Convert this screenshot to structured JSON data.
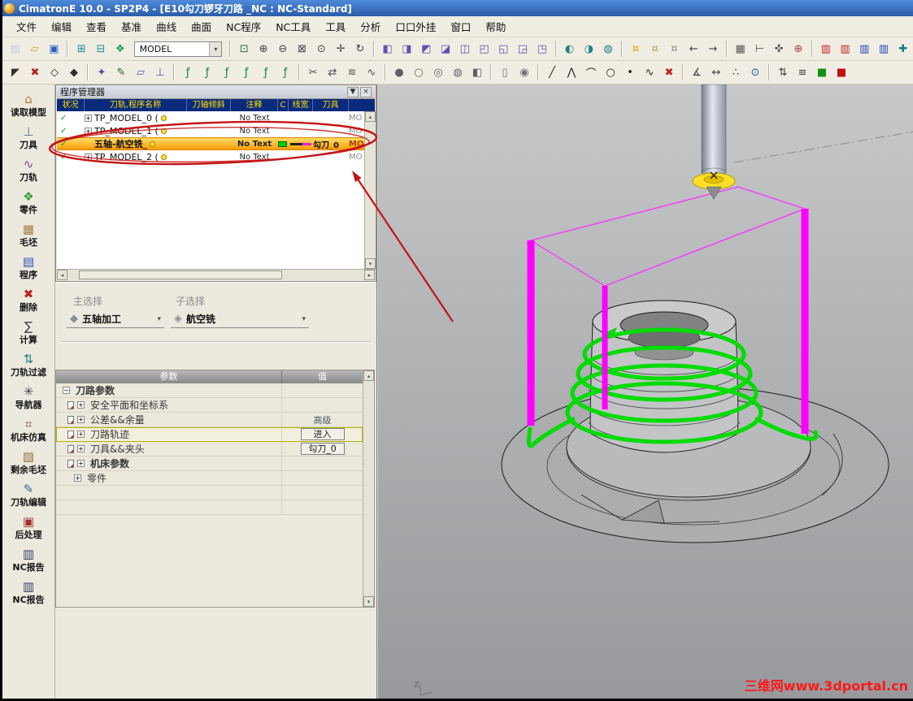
{
  "window": {
    "title": "CimatronE 10.0 - SP2P4 - [E10勾刀锣牙刀路 _NC : NC-Standard]"
  },
  "glyphs": {
    "dropdown": "▾",
    "check": "✓",
    "close": "×",
    "pin": "▼",
    "scroll_left": "◂",
    "scroll_right": "▸",
    "scroll_up": "▴",
    "scroll_down": "▾"
  },
  "menus": [
    {
      "id": "file",
      "label": "文件"
    },
    {
      "id": "edit",
      "label": "编辑"
    },
    {
      "id": "view",
      "label": "查看"
    },
    {
      "id": "datum",
      "label": "基准"
    },
    {
      "id": "curve",
      "label": "曲线"
    },
    {
      "id": "surface",
      "label": "曲面"
    },
    {
      "id": "nc-program",
      "label": "NC程序"
    },
    {
      "id": "nc-tools",
      "label": "NC工具"
    },
    {
      "id": "tools",
      "label": "工具"
    },
    {
      "id": "analysis",
      "label": "分析"
    },
    {
      "id": "plugins",
      "label": "口口外挂"
    },
    {
      "id": "window",
      "label": "窗口"
    },
    {
      "id": "help",
      "label": "帮助"
    }
  ],
  "toolbar1": {
    "model_selector": "MODEL",
    "items": [
      {
        "name": "new-file-icon",
        "glyph": "▤",
        "color": "#c8ccdc"
      },
      {
        "name": "open-file-icon",
        "glyph": "▱",
        "color": "#d89c18"
      },
      {
        "name": "save-icon",
        "glyph": "▣",
        "color": "#2a58c0"
      },
      {
        "type": "sep"
      },
      {
        "name": "import-model-icon",
        "glyph": "⊞",
        "color": "#189090"
      },
      {
        "name": "export-model-icon",
        "glyph": "⊟",
        "color": "#189090"
      },
      {
        "name": "dataset-icon",
        "glyph": "❖",
        "color": "#18a050"
      },
      {
        "type": "combo"
      },
      {
        "type": "sep"
      },
      {
        "name": "zoom-window-icon",
        "glyph": "⊡",
        "color": "#207040"
      },
      {
        "name": "zoom-in-icon",
        "glyph": "⊕",
        "color": "#404040"
      },
      {
        "name": "zoom-out-icon",
        "glyph": "⊖",
        "color": "#404040"
      },
      {
        "name": "zoom-fit-icon",
        "glyph": "⊠",
        "color": "#404040"
      },
      {
        "name": "zoom-all-icon",
        "glyph": "⊙",
        "color": "#404040"
      },
      {
        "name": "pan-icon",
        "glyph": "✛",
        "color": "#404040"
      },
      {
        "name": "rotate-view-icon",
        "glyph": "↻",
        "color": "#404040"
      },
      {
        "type": "sep"
      },
      {
        "name": "iso-view-icon",
        "glyph": "◧",
        "color": "#6050b0"
      },
      {
        "name": "front-view-icon",
        "glyph": "◨",
        "color": "#6050b0"
      },
      {
        "name": "back-view-icon",
        "glyph": "◩",
        "color": "#6050b0"
      },
      {
        "name": "left-view-icon",
        "glyph": "◪",
        "color": "#6050b0"
      },
      {
        "name": "right-view-icon",
        "glyph": "◫",
        "color": "#6050b0"
      },
      {
        "name": "top-view-icon",
        "glyph": "◰",
        "color": "#6050b0"
      },
      {
        "name": "bottom-view-icon",
        "glyph": "◱",
        "color": "#6050b0"
      },
      {
        "name": "axono-view-icon",
        "glyph": "◲",
        "color": "#6050b0"
      },
      {
        "name": "named-view-icon",
        "glyph": "◳",
        "color": "#6050b0"
      },
      {
        "type": "sep"
      },
      {
        "name": "shaded-mode-icon",
        "glyph": "◐",
        "color": "#188080"
      },
      {
        "name": "wireframe-mode-icon",
        "glyph": "◑",
        "color": "#188080"
      },
      {
        "name": "hidden-mode-icon",
        "glyph": "◍",
        "color": "#188080"
      },
      {
        "type": "sep"
      },
      {
        "name": "light-on-icon",
        "glyph": "¤",
        "color": "#d8a000"
      },
      {
        "name": "light-half-icon",
        "glyph": "¤",
        "color": "#b0a058"
      },
      {
        "name": "light-off-icon",
        "glyph": "¤",
        "color": "#8a8a8a"
      },
      {
        "name": "back-arrow-icon",
        "glyph": "←",
        "color": "#404040"
      },
      {
        "name": "forward-arrow-icon",
        "glyph": "→",
        "color": "#404040"
      },
      {
        "type": "sep"
      },
      {
        "name": "grid-icon",
        "glyph": "▦",
        "color": "#585858"
      },
      {
        "name": "ruler-icon",
        "glyph": "⊢",
        "color": "#585858"
      },
      {
        "name": "snap-icon",
        "glyph": "✜",
        "color": "#585858"
      },
      {
        "name": "origin-icon",
        "glyph": "⊕",
        "color": "#a04040"
      },
      {
        "type": "sep"
      },
      {
        "name": "simulator-monitor-icon",
        "glyph": "▥",
        "color": "#c02020"
      },
      {
        "name": "simulator-run-icon",
        "glyph": "▥",
        "color": "#c02020"
      },
      {
        "name": "nc-doc-view-icon",
        "glyph": "▥",
        "color": "#2040c0"
      },
      {
        "name": "nc-doc-edit-icon",
        "glyph": "▥",
        "color": "#2040c0"
      },
      {
        "name": "probe-icon",
        "glyph": "✚",
        "color": "#108080"
      }
    ]
  },
  "toolbar2": {
    "items": [
      {
        "name": "select-icon",
        "glyph": "◤",
        "color": "#303030"
      },
      {
        "name": "unselect-icon",
        "glyph": "✖",
        "color": "#b02020"
      },
      {
        "name": "pick-filter-icon",
        "glyph": "◇",
        "color": "#303030"
      },
      {
        "name": "selection-set-icon",
        "glyph": "◆",
        "color": "#303030"
      },
      {
        "type": "sep"
      },
      {
        "name": "feature-icon",
        "glyph": "✦",
        "color": "#6040a0"
      },
      {
        "name": "sketch-icon",
        "glyph": "✎",
        "color": "#206020"
      },
      {
        "name": "datum-plane-icon",
        "glyph": "▱",
        "color": "#4060a0"
      },
      {
        "name": "ucs-icon",
        "glyph": "⊥",
        "color": "#4060a0"
      },
      {
        "type": "sep"
      },
      {
        "name": "function-curve-1-icon",
        "glyph": "ƒ",
        "color": "#0f8040"
      },
      {
        "name": "function-curve-2-icon",
        "glyph": "ƒ",
        "color": "#0f8040"
      },
      {
        "name": "function-curve-3-icon",
        "glyph": "ƒ",
        "color": "#0f8040"
      },
      {
        "name": "function-curve-4-icon",
        "glyph": "ƒ",
        "color": "#0f8040"
      },
      {
        "name": "function-curve-5-icon",
        "glyph": "ƒ",
        "color": "#0f8040"
      },
      {
        "name": "function-curve-6-icon",
        "glyph": "ƒ",
        "color": "#0f8040"
      },
      {
        "type": "sep"
      },
      {
        "name": "trim-icon",
        "glyph": "✂",
        "color": "#505050"
      },
      {
        "name": "flip-icon",
        "glyph": "⇄",
        "color": "#505050"
      },
      {
        "name": "offset-icon",
        "glyph": "≋",
        "color": "#505050"
      },
      {
        "name": "blend-icon",
        "glyph": "∿",
        "color": "#505050"
      },
      {
        "type": "sep"
      },
      {
        "name": "shaded-display-icon",
        "glyph": "●",
        "color": "#606060"
      },
      {
        "name": "wire-display-icon",
        "glyph": "○",
        "color": "#606060"
      },
      {
        "name": "hidden-line-icon",
        "glyph": "◎",
        "color": "#606060"
      },
      {
        "name": "transparency-icon",
        "glyph": "◍",
        "color": "#606060"
      },
      {
        "name": "section-view-icon",
        "glyph": "◧",
        "color": "#606060"
      },
      {
        "type": "sep"
      },
      {
        "name": "cylinder-icon",
        "glyph": "▯",
        "color": "#707070"
      },
      {
        "name": "sphere-icon",
        "glyph": "◉",
        "color": "#707070"
      },
      {
        "type": "sep"
      },
      {
        "name": "line-icon",
        "glyph": "╱",
        "color": "#202020"
      },
      {
        "name": "polyline-icon",
        "glyph": "⋀",
        "color": "#202020"
      },
      {
        "name": "arc-icon",
        "glyph": "⌒",
        "color": "#202020"
      },
      {
        "name": "circle-icon",
        "glyph": "○",
        "color": "#202020"
      },
      {
        "name": "point-icon",
        "glyph": "•",
        "color": "#202020"
      },
      {
        "name": "spline-icon",
        "glyph": "∿",
        "color": "#202020"
      },
      {
        "name": "delete-geometry-icon",
        "glyph": "✖",
        "color": "#c02020"
      },
      {
        "type": "sep"
      },
      {
        "name": "measure-angle-icon",
        "glyph": "∡",
        "color": "#404040"
      },
      {
        "name": "measure-distance-icon",
        "glyph": "↔",
        "color": "#404040"
      },
      {
        "name": "analyze-icon",
        "glyph": "∴",
        "color": "#404040"
      },
      {
        "name": "info-icon",
        "glyph": "⊙",
        "color": "#2050c0"
      },
      {
        "type": "sep"
      },
      {
        "name": "verify-icon",
        "glyph": "⇅",
        "color": "#404040"
      },
      {
        "name": "batch-icon",
        "glyph": "≡",
        "color": "#404040"
      },
      {
        "name": "confirm-icon",
        "glyph": "■",
        "color": "#109010"
      },
      {
        "name": "cancel-icon",
        "glyph": "■",
        "color": "#c01010"
      }
    ]
  },
  "sidebar": {
    "items": [
      {
        "id": "read-model",
        "label": "读取模型",
        "glyph": "⌂",
        "color": "#b07828"
      },
      {
        "id": "cutter",
        "label": "刀具",
        "glyph": "⊥",
        "color": "#607080"
      },
      {
        "id": "toolpath",
        "label": "刀轨",
        "glyph": "∿",
        "color": "#8040a0"
      },
      {
        "id": "part",
        "label": "零件",
        "glyph": "❖",
        "color": "#30a030"
      },
      {
        "id": "stock",
        "label": "毛坯",
        "glyph": "▦",
        "color": "#a08040"
      },
      {
        "id": "program",
        "label": "程序",
        "glyph": "▤",
        "color": "#3050b0"
      },
      {
        "id": "delete",
        "label": "删除",
        "glyph": "✖",
        "color": "#c02020"
      },
      {
        "id": "calculate",
        "label": "计算",
        "glyph": "∑",
        "color": "#404040"
      },
      {
        "id": "toolpath-filter",
        "label": "刀轨过滤",
        "glyph": "⇅",
        "color": "#208080"
      },
      {
        "id": "navigator",
        "label": "导航器",
        "glyph": "✳",
        "color": "#404040"
      },
      {
        "id": "machine-simulation",
        "label": "机床仿真",
        "glyph": "⌗",
        "color": "#705020"
      },
      {
        "id": "remaining-stock",
        "label": "剩余毛坯",
        "glyph": "▧",
        "color": "#907040"
      },
      {
        "id": "toolpath-edit",
        "label": "刀轨编辑",
        "glyph": "✎",
        "color": "#406090"
      },
      {
        "id": "post-process",
        "label": "后处理",
        "glyph": "▣",
        "color": "#a03030"
      },
      {
        "id": "nc-report",
        "label": "NC报告",
        "glyph": "▥",
        "color": "#304060"
      },
      {
        "id": "nc-report-2",
        "label": "NC报告",
        "glyph": "▥",
        "color": "#304060"
      }
    ]
  },
  "program_manager": {
    "title": "程序管理器",
    "columns": [
      "状况",
      "刀轨,程序名称",
      "刀轴倾斜",
      "注释",
      "C",
      "线宽",
      "刀具"
    ],
    "rows": [
      {
        "name": "TP_MODEL_0 (",
        "comment": "No Text",
        "tool": "",
        "extra": "MO",
        "expandable": true,
        "selected": false
      },
      {
        "name": "TP_MODEL_1 (",
        "comment": "No Text",
        "tool": "",
        "extra": "MO",
        "expandable": true,
        "selected": false
      },
      {
        "name": "五轴-航空铣_",
        "comment": "No Text",
        "tool": "勾刀_0",
        "extra": "MO",
        "expandable": false,
        "selected": true,
        "swatch": "#00cc00",
        "line_sample": true
      },
      {
        "name": "TP_MODEL_2 (",
        "comment": "No Text",
        "tool": "",
        "extra": "MO",
        "expandable": true,
        "selected": false
      }
    ]
  },
  "selection": {
    "primary_label": "主选择",
    "secondary_label": "子选择",
    "primary": {
      "value": "五轴加工",
      "glyph": "◆"
    },
    "secondary": {
      "value": "航空铣",
      "glyph": "◈"
    }
  },
  "parameters": {
    "header": [
      "参数",
      "值"
    ],
    "rows": [
      {
        "label": "刀路参数",
        "expand": "minus",
        "bold": true,
        "indent": 8
      },
      {
        "label": "安全平面和坐标系",
        "expand": "plus",
        "icon": true,
        "indent": 14
      },
      {
        "label": "公差&&余量",
        "expand": "plus",
        "icon": true,
        "indent": 14,
        "value": "高级",
        "value_style": "text"
      },
      {
        "label": "刀路轨迹",
        "expand": "plus",
        "icon": true,
        "indent": 14,
        "value": "进入",
        "value_style": "button",
        "selected": true
      },
      {
        "label": "刀具&&夹头",
        "expand": "plus",
        "icon": true,
        "indent": 14,
        "value": "勾刀_0",
        "value_style": "button"
      },
      {
        "label": "机床参数",
        "expand": "plus",
        "icon": true,
        "indent": 14,
        "bold": true
      },
      {
        "label": "零件",
        "expand": "plus",
        "indent": 22
      },
      {},
      {}
    ]
  },
  "viewport": {
    "axis_label": "Z"
  },
  "watermark": "三维网www.3dportal.cn",
  "colors": {
    "toolpath": "#00dc00",
    "fixture": "#ff00ff",
    "fixture_thin": "#ff30ff",
    "highlight": "#ffaa00",
    "annotation": "#c41414",
    "header_navy": "#0a2a7c",
    "header_text": "#ffe000",
    "watermark_red": "#ff1818"
  }
}
